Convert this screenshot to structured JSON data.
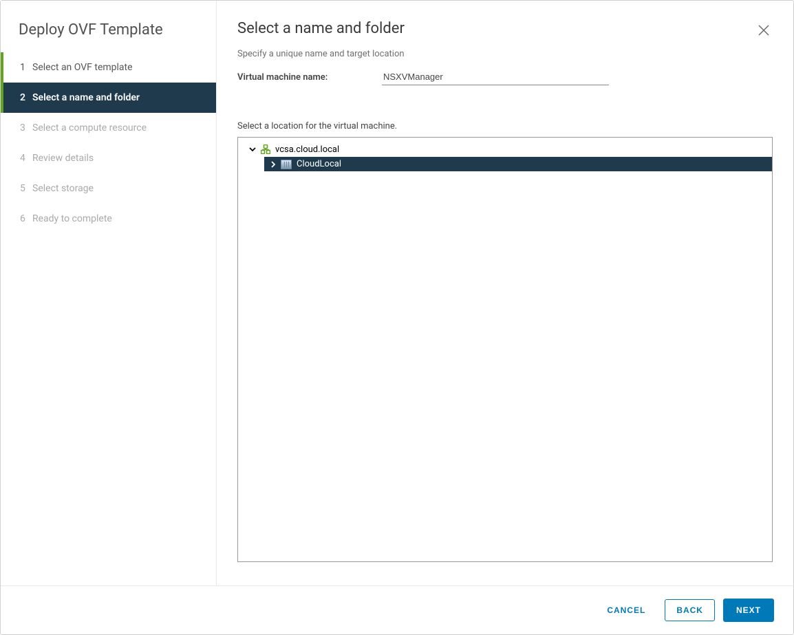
{
  "sidebar": {
    "title": "Deploy OVF Template",
    "steps": [
      {
        "num": "1",
        "label": "Select an OVF template",
        "state": "done"
      },
      {
        "num": "2",
        "label": "Select a name and folder",
        "state": "current"
      },
      {
        "num": "3",
        "label": "Select a compute resource",
        "state": "future"
      },
      {
        "num": "4",
        "label": "Review details",
        "state": "future"
      },
      {
        "num": "5",
        "label": "Select storage",
        "state": "future"
      },
      {
        "num": "6",
        "label": "Ready to complete",
        "state": "future"
      }
    ]
  },
  "main": {
    "title": "Select a name and folder",
    "subtitle": "Specify a unique name and target location",
    "vm_name_label": "Virtual machine name:",
    "vm_name_value": "NSXVManager",
    "location_label": "Select a location for the virtual machine.",
    "tree": {
      "root": {
        "label": "vcsa.cloud.local",
        "expanded": true
      },
      "child": {
        "label": "CloudLocal",
        "expanded": false,
        "selected": true
      }
    }
  },
  "footer": {
    "cancel": "CANCEL",
    "back": "BACK",
    "next": "NEXT"
  }
}
